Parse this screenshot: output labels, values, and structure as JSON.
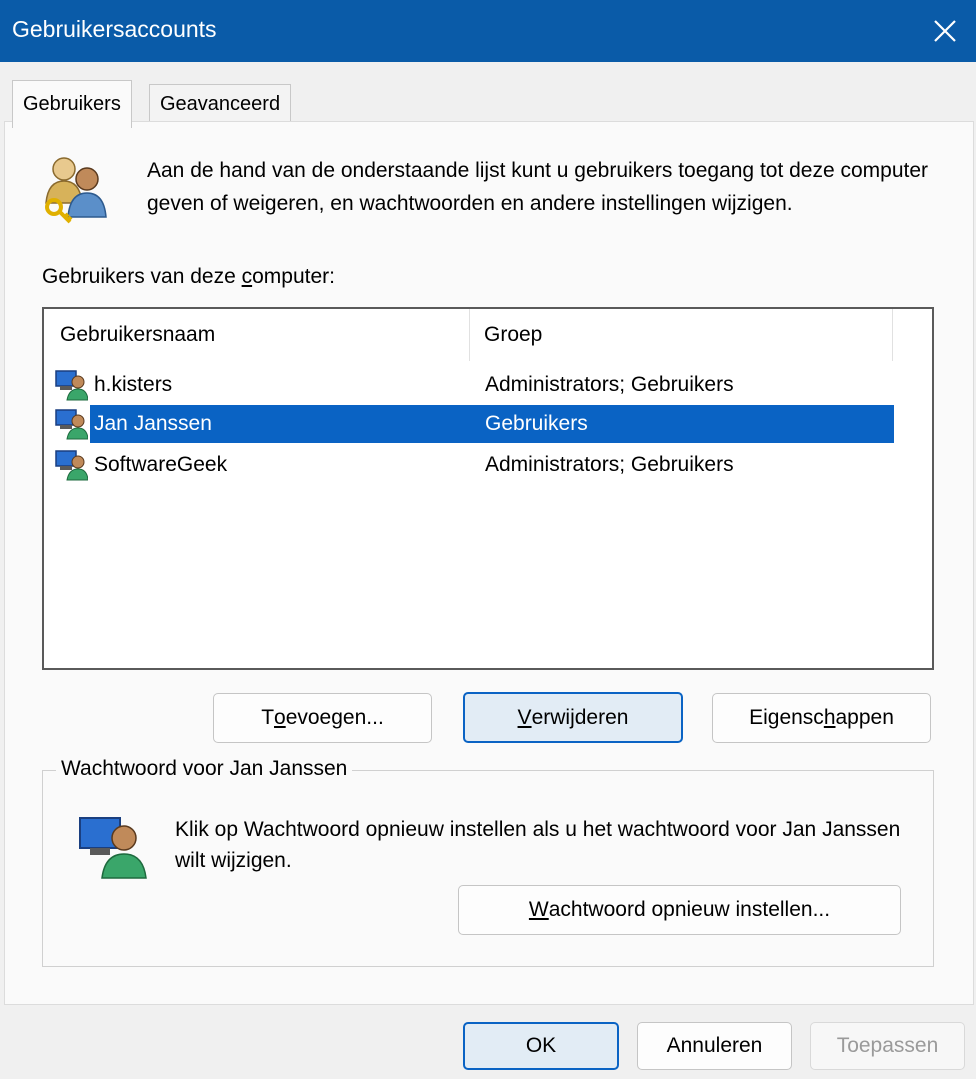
{
  "window": {
    "title": "Gebruikersaccounts",
    "title_bar_color": "#0a5ba8"
  },
  "tabs": [
    {
      "label": "Gebruikers",
      "active": true
    },
    {
      "label": "Geavanceerd",
      "active": false
    }
  ],
  "intro": {
    "icon": "users-key-icon",
    "text": "Aan de hand van de onderstaande lijst kunt u gebruikers toegang tot deze computer geven of weigeren, en wachtwoorden en andere instellingen wijzigen."
  },
  "users_list": {
    "caption_before": "Gebruikers van deze ",
    "caption_accel": "c",
    "caption_after": "omputer:",
    "columns": [
      "Gebruikersnaam",
      "Groep"
    ],
    "rows": [
      {
        "name": "h.kisters",
        "group": "Administrators; Gebruikers",
        "selected": false,
        "icon": "user-computer-icon"
      },
      {
        "name": "Jan Janssen",
        "group": "Gebruikers",
        "selected": true,
        "icon": "user-computer-icon"
      },
      {
        "name": "SoftwareGeek",
        "group": "Administrators; Gebruikers",
        "selected": false,
        "icon": "user-computer-icon"
      }
    ],
    "selection_color": "#0a63c4"
  },
  "list_buttons": {
    "add": {
      "before": "T",
      "accel": "o",
      "after": "evoegen..."
    },
    "remove": {
      "before": "",
      "accel": "V",
      "after": "erwijderen"
    },
    "properties": {
      "before": "Eigensc",
      "accel": "h",
      "after": "appen"
    }
  },
  "password_group": {
    "legend": "Wachtwoord voor Jan Janssen",
    "icon": "user-computer-icon",
    "text": "Klik op Wachtwoord opnieuw instellen als u het wachtwoord voor Jan Janssen wilt wijzigen.",
    "reset_button": {
      "before": "",
      "accel": "W",
      "after": "achtwoord opnieuw instellen..."
    }
  },
  "footer": {
    "ok": "OK",
    "cancel": "Annuleren",
    "apply": "Toepassen",
    "apply_enabled": false
  }
}
